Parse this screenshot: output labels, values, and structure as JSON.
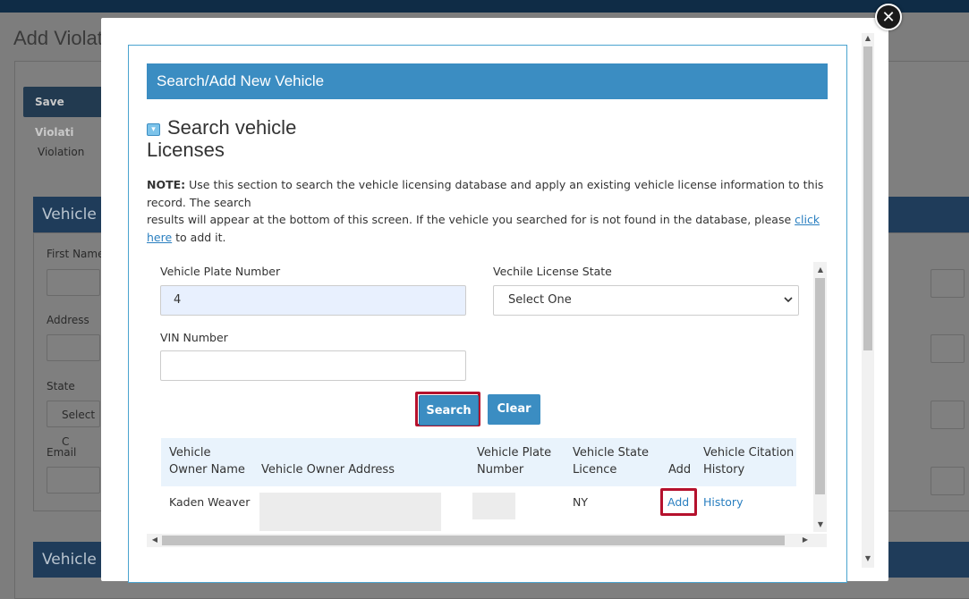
{
  "background": {
    "page_title": "Add Violat",
    "save_button": "Save Violati",
    "tab": "Violation",
    "section1": "Vehicle C",
    "section2": "Vehicle In",
    "labels": {
      "first_name": "First Name",
      "address": "Address",
      "state": "State",
      "email": "Email"
    },
    "state_select": "Select C"
  },
  "modal": {
    "header": "Search/Add New Vehicle",
    "section_title": "Search vehicle Licenses",
    "note": {
      "label": "NOTE:",
      "text1": " Use this section to search the vehicle licensing database and apply an existing vehicle license information to this record. The search",
      "text2": "results will appear at the bottom of this screen. If the vehicle you searched for is not found in the database, please ",
      "link": "click here",
      "text3": " to add it."
    },
    "form": {
      "plate_label": "Vehicle Plate Number",
      "plate_value": "4",
      "state_label": "Vechile License State",
      "state_value": "Select One",
      "vin_label": "VIN Number",
      "vin_value": "",
      "search_button": "Search",
      "clear_button": "Clear"
    },
    "table": {
      "headers": [
        "Vehicle Owner Name",
        "Vehicle Owner Address",
        "Vehicle Plate Number",
        "Vehicle State Licence",
        "Add",
        "Vehicle Citation History"
      ],
      "rows": [
        {
          "owner": "Kaden Weaver",
          "address": "",
          "plate": "",
          "state": "NY",
          "add": "Add",
          "history": "History"
        }
      ]
    },
    "close_icon": "close-icon"
  }
}
